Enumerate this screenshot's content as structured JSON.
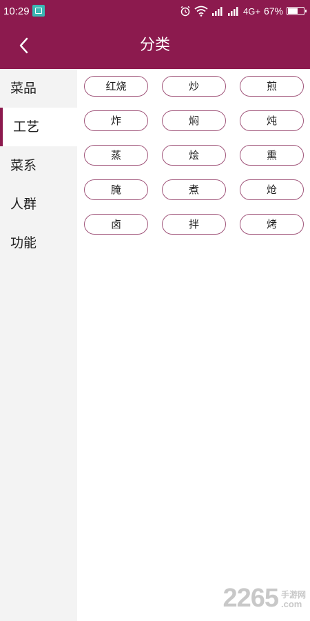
{
  "status_bar": {
    "time": "10:29",
    "network": "4G+",
    "battery_percent": "67%",
    "battery_level": 0.67,
    "icons": [
      "screenshot-app-icon",
      "alarm-icon",
      "wifi-icon",
      "signal-icon",
      "signal-icon",
      "battery-icon"
    ]
  },
  "header": {
    "title": "分类",
    "back_icon": "chevron-left-icon",
    "color": "#8c1a4e"
  },
  "sidebar": {
    "items": [
      {
        "label": "菜品",
        "active": false
      },
      {
        "label": "工艺",
        "active": true
      },
      {
        "label": "菜系",
        "active": false
      },
      {
        "label": "人群",
        "active": false
      },
      {
        "label": "功能",
        "active": false
      }
    ]
  },
  "tags": [
    "红烧",
    "炒",
    "煎",
    "炸",
    "焖",
    "炖",
    "蒸",
    "烩",
    "熏",
    "腌",
    "煮",
    "炝",
    "卤",
    "拌",
    "烤"
  ],
  "watermark": {
    "number": "2265",
    "label": "手游网",
    "domain": ".com"
  }
}
